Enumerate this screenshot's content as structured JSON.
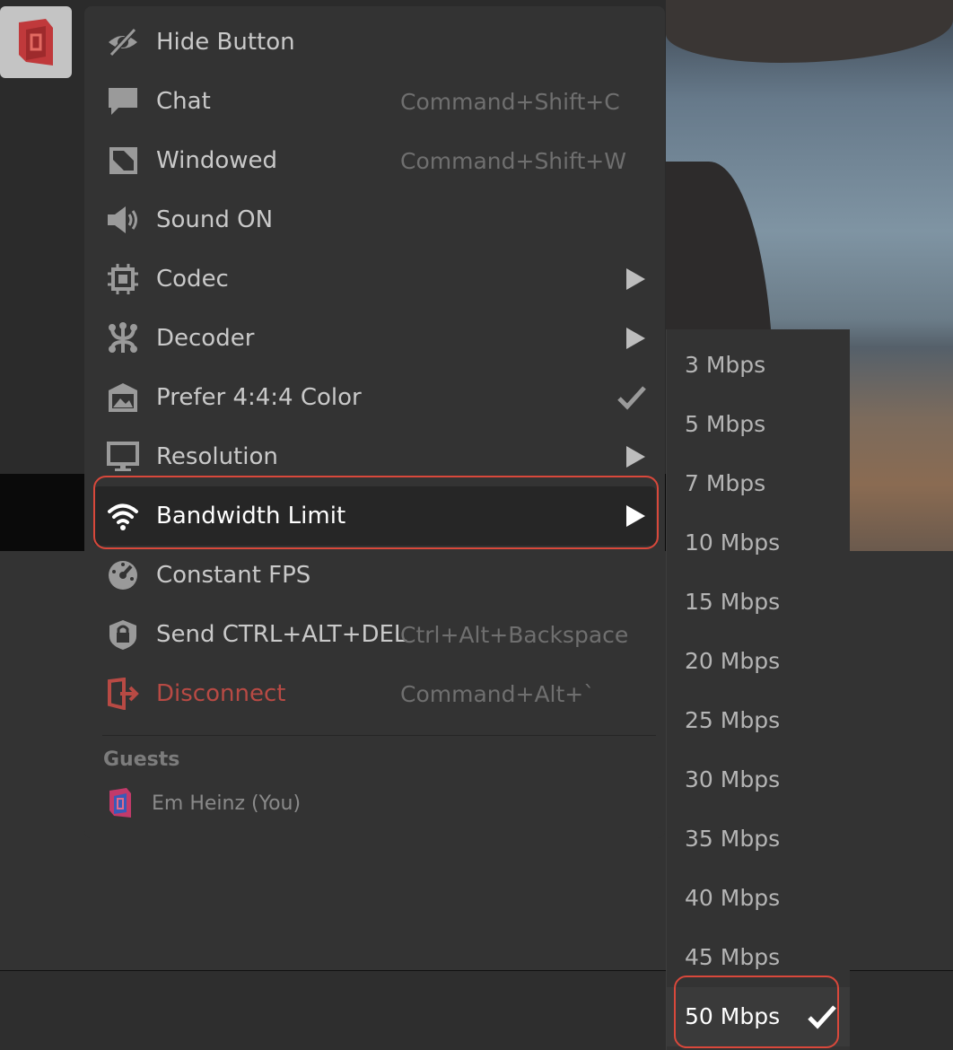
{
  "menu": {
    "items": [
      {
        "label": "Hide Button",
        "icon": "hidden-eye-icon",
        "shortcut": ""
      },
      {
        "label": "Chat",
        "icon": "chat-bubble-icon",
        "shortcut": "Command+Shift+C"
      },
      {
        "label": "Windowed",
        "icon": "windowed-icon",
        "shortcut": "Command+Shift+W"
      },
      {
        "label": "Sound ON",
        "icon": "speaker-icon",
        "shortcut": ""
      },
      {
        "label": "Codec",
        "icon": "chip-icon",
        "shortcut": "",
        "submenu": true
      },
      {
        "label": "Decoder",
        "icon": "decoder-icon",
        "shortcut": "",
        "submenu": true
      },
      {
        "label": "Prefer 4:4:4 Color",
        "icon": "picture-icon",
        "shortcut": "",
        "checked": true
      },
      {
        "label": "Resolution",
        "icon": "monitor-icon",
        "shortcut": "",
        "submenu": true
      },
      {
        "label": "Bandwidth Limit",
        "icon": "wifi-icon",
        "shortcut": "",
        "submenu": true,
        "selected": true
      },
      {
        "label": "Constant FPS",
        "icon": "gauge-icon",
        "shortcut": ""
      },
      {
        "label": "Send CTRL+ALT+DEL",
        "icon": "lock-shield-icon",
        "shortcut": "Ctrl+Alt+Backspace"
      },
      {
        "label": "Disconnect",
        "icon": "disconnect-icon",
        "shortcut": "Command+Alt+`",
        "danger": true
      }
    ],
    "guests_title": "Guests",
    "guests": [
      {
        "name": "Em Heinz (You)",
        "icon": "parsec-logo-icon"
      }
    ]
  },
  "bandwidth_submenu": {
    "options": [
      "3 Mbps",
      "5 Mbps",
      "7 Mbps",
      "10 Mbps",
      "15 Mbps",
      "20 Mbps",
      "25 Mbps",
      "30 Mbps",
      "35 Mbps",
      "40 Mbps",
      "45 Mbps",
      "50 Mbps"
    ],
    "selected": "50 Mbps"
  },
  "colors": {
    "highlight_ring": "#d9483b",
    "danger": "#b84a44",
    "menu_bg": "#333333",
    "logo_red": "#c0393b"
  }
}
